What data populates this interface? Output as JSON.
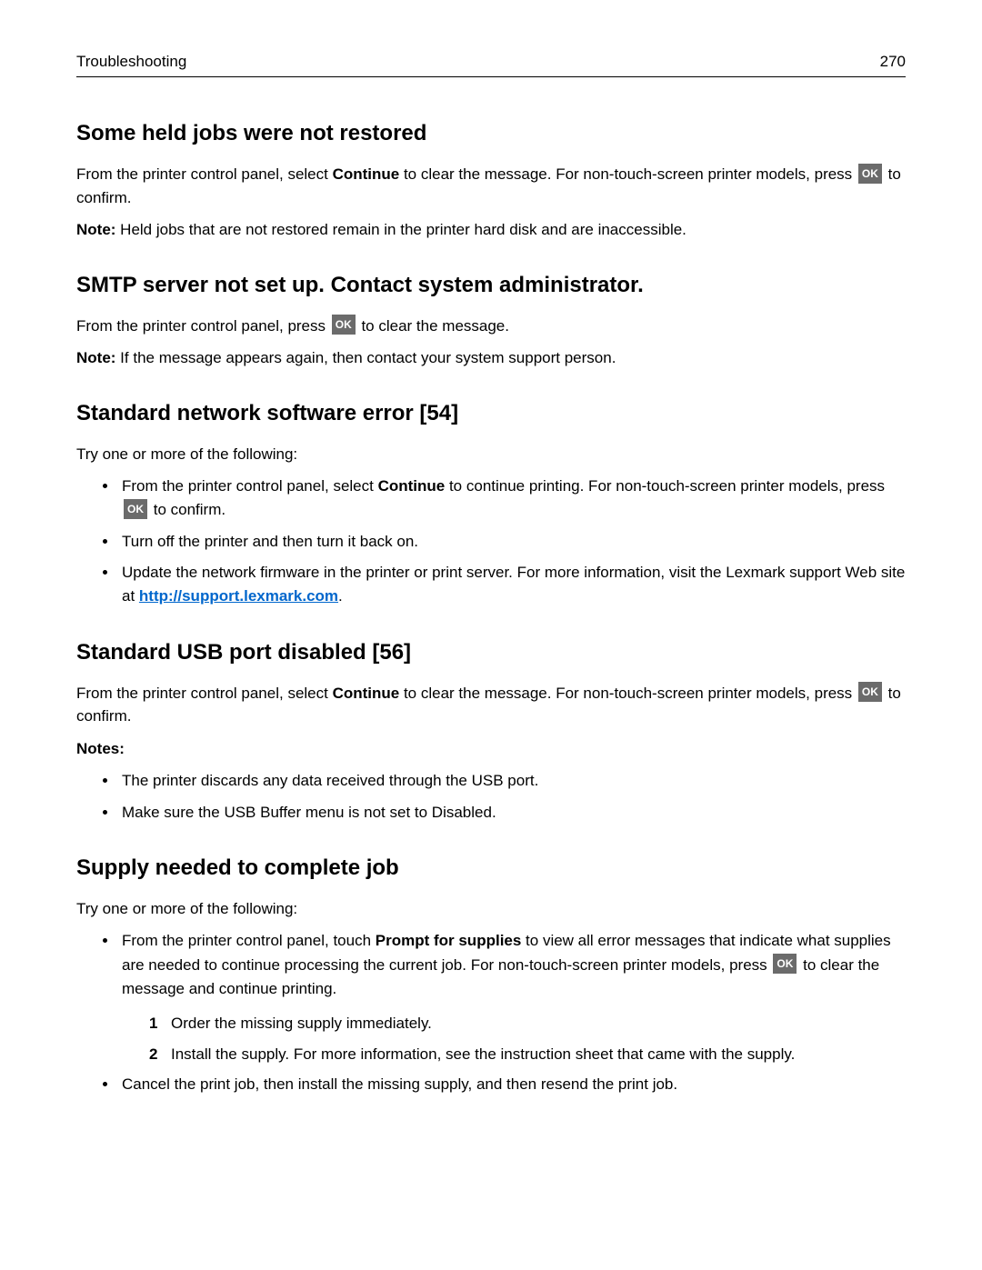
{
  "header": {
    "title": "Troubleshooting",
    "page_number": "270"
  },
  "sections": {
    "s1": {
      "heading": "Some held jobs were not restored",
      "para_a": "From the printer control panel, select ",
      "bold_continue": "Continue",
      "para_b": " to clear the message. For non‑touch‑screen printer models, press ",
      "para_c": " to confirm.",
      "note_label": "Note:",
      "note_text": " Held jobs that are not restored remain in the printer hard disk and are inaccessible."
    },
    "s2": {
      "heading": "SMTP server not set up. Contact system administrator.",
      "para_a": "From the printer control panel, press ",
      "para_b": " to clear the message.",
      "note_label": "Note:",
      "note_text": " If the message appears again, then contact your system support person."
    },
    "s3": {
      "heading": "Standard network software error [54]",
      "intro": "Try one or more of the following:",
      "b1_a": "From the printer control panel, select ",
      "b1_bold": "Continue",
      "b1_b": " to continue printing. For non‑touch‑screen printer models, press ",
      "b1_c": " to confirm.",
      "b2": "Turn off the printer and then turn it back on.",
      "b3_a": "Update the network firmware in the printer or print server. For more information, visit the Lexmark support Web site at ",
      "b3_link": "http://support.lexmark.com",
      "b3_b": "."
    },
    "s4": {
      "heading": "Standard USB port disabled [56]",
      "para_a": "From the printer control panel, select ",
      "bold_continue": "Continue",
      "para_b": " to clear the message. For non‑touch‑screen printer models, press ",
      "para_c": " to confirm.",
      "notes_label": "Notes:",
      "n1": "The printer discards any data received through the USB port.",
      "n2": "Make sure the USB Buffer menu is not set to Disabled."
    },
    "s5": {
      "heading": "Supply needed to complete job",
      "intro": "Try one or more of the following:",
      "b1_a": "From the printer control panel, touch ",
      "b1_bold": "Prompt for supplies",
      "b1_b": " to view all error messages that indicate what supplies are needed to continue processing the current job. For non‑touch‑screen printer models, press ",
      "b1_c": " to clear the message and continue printing.",
      "step1": "Order the missing supply immediately.",
      "step2": "Install the supply. For more information, see the instruction sheet that came with the supply.",
      "b2": "Cancel the print job, then install the missing supply, and then resend the print job."
    }
  },
  "ok_label": "OK"
}
